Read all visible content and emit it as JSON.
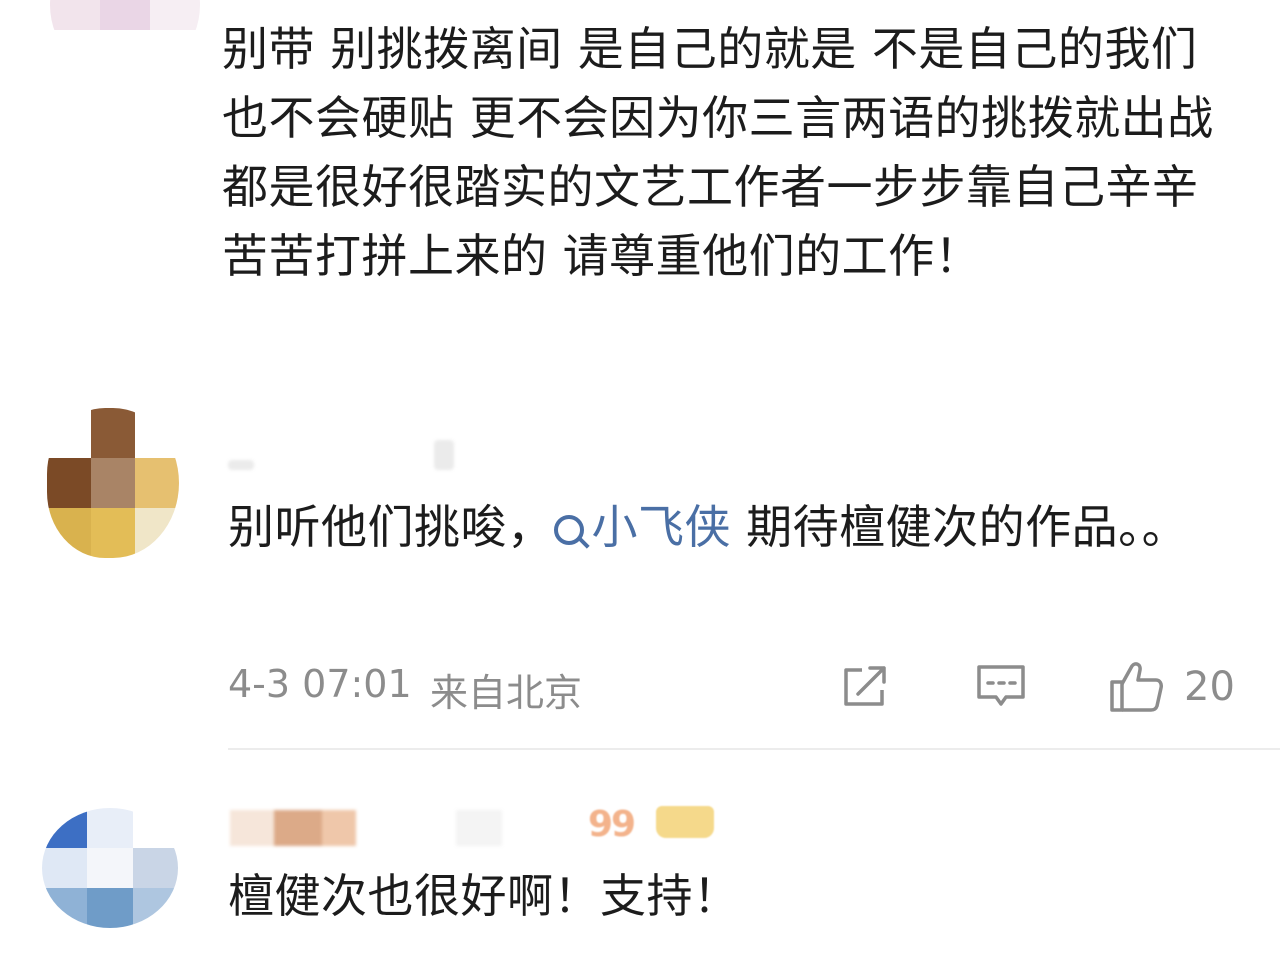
{
  "comments": [
    {
      "text": "别带 别挑拨离间 是自己的就是 不是自己的我们也不会硬贴 更不会因为你三言两语的挑拨就出战 都是很好很踏实的文艺工作者一步步靠自己辛辛苦苦打拼上来的 请尊重他们的工作！",
      "avatar_colors": [
        "#f4e8ef",
        "#d8a8cc",
        "#ffffff",
        "#f2e4ec",
        "#ead6e6",
        "#f6eef3",
        "#ffffff",
        "#ffffff",
        "#ffffff"
      ]
    },
    {
      "text_before": "别听他们挑唆，",
      "mention": "小飞侠",
      "text_after": " 期待檀健次的作品。。",
      "time": "4-3 07:01",
      "location": "来自北京",
      "likes": "20",
      "avatar_colors": [
        "#ffffff",
        "#8a5a36",
        "#ffffff",
        "#7b4a26",
        "#a98466",
        "#e6c070",
        "#d9b24e",
        "#e3bd57",
        "#f0e6c8"
      ]
    },
    {
      "text": "檀健次也很好啊！支持！",
      "level": "99",
      "avatar_colors": [
        "#3d6fc4",
        "#e8eef8",
        "#ffffff",
        "#dfe8f5",
        "#f4f6fa",
        "#c9d5e6",
        "#8fb2d6",
        "#6f9cc8",
        "#aec6e0"
      ]
    }
  ],
  "icons": {
    "share": "share-icon",
    "comment": "comment-icon",
    "like": "thumbs-up-icon",
    "mention": "search-icon"
  },
  "colors": {
    "mention": "#4a6fa5",
    "meta": "#8c8c8c",
    "level_badge": "#f3b38c"
  }
}
